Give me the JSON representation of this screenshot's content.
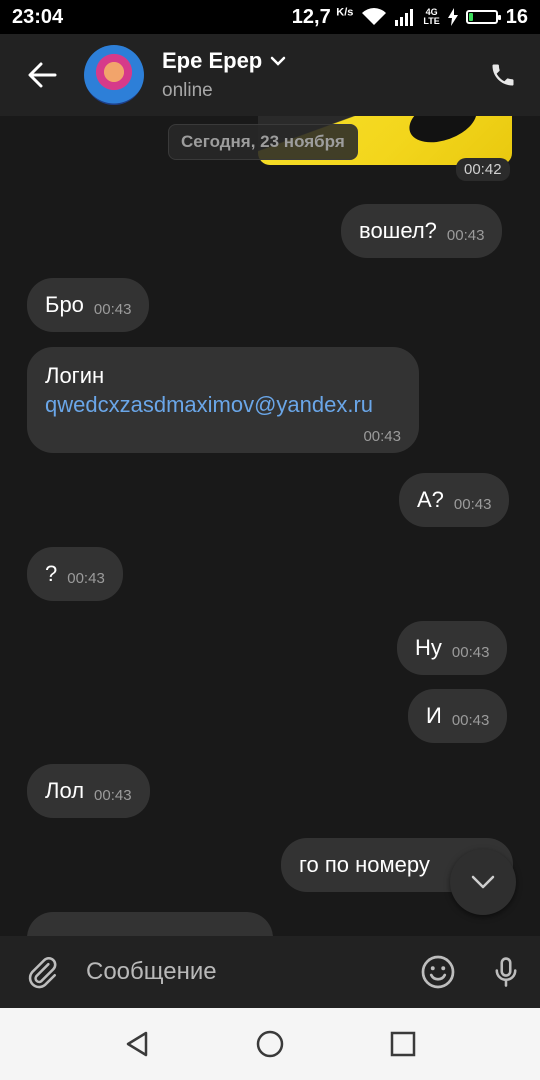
{
  "status_bar": {
    "time": "23:04",
    "speed": "12,7",
    "speed_unit": "K/s",
    "network": "4G",
    "network_sub": "LTE",
    "battery": "16",
    "battery_level": 0.16
  },
  "header": {
    "contact_name": "Ере Ерер",
    "status": "online",
    "icons": {
      "back": "arrow-left-icon",
      "call": "phone-icon",
      "dropdown": "chevron-down-icon"
    }
  },
  "chat": {
    "date_separator": "Сегодня, 23 ноября",
    "photo_time": "00:42",
    "messages": [
      {
        "side": "out",
        "text": "вошел?",
        "time": "00:43"
      },
      {
        "side": "in",
        "text": "Бро",
        "time": "00:43"
      },
      {
        "side": "in",
        "text": "Логин",
        "link": "qwedcxzasdmaximov@yandex.ru",
        "time": "00:43"
      },
      {
        "side": "out",
        "text": "А?",
        "time": "00:43"
      },
      {
        "side": "in",
        "text": "?",
        "time": "00:43"
      },
      {
        "side": "out",
        "text": "Ну",
        "time": "00:43"
      },
      {
        "side": "out",
        "text": "И",
        "time": "00:43"
      },
      {
        "side": "in",
        "text": "Лол",
        "time": "00:43"
      },
      {
        "side": "out",
        "text": "го по номеру",
        "time": ""
      }
    ]
  },
  "composer": {
    "placeholder": "Сообщение",
    "icons": {
      "attach": "paperclip-icon",
      "emoji": "emoji-icon",
      "mic": "microphone-icon"
    }
  },
  "colors": {
    "chat_bg": "#191919",
    "bubble": "#333333",
    "header_bg": "#222222",
    "link": "#6aa6e8",
    "time": "#9b9b9b"
  }
}
